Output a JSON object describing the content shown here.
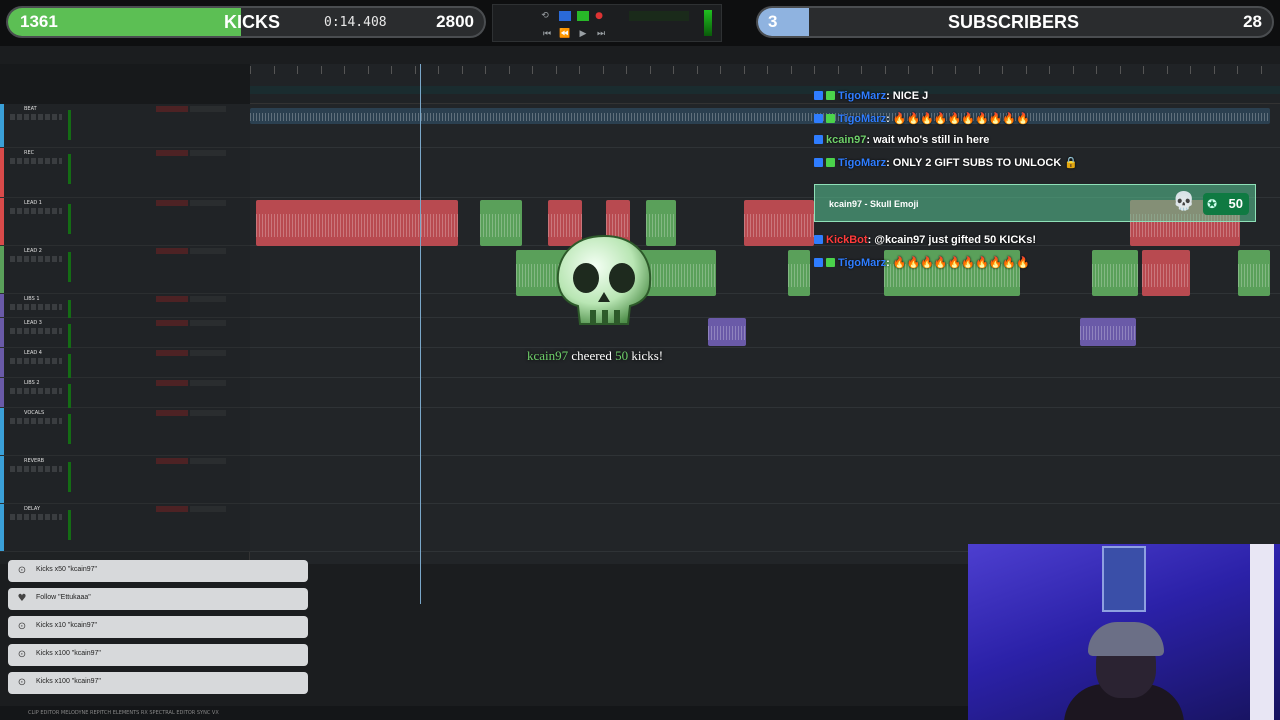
{
  "kicks_goal": {
    "left_value": "1361",
    "title": "KICKS",
    "timer": "0:14.408",
    "right_value": "2800",
    "progress_fraction": 0.49,
    "fill_color": "#5cbf54"
  },
  "subs_goal": {
    "left_value": "3",
    "title": "SUBSCRIBERS",
    "right_value": "28",
    "progress_fraction": 0.1,
    "fill_color": "#8fb3e0"
  },
  "chat": [
    {
      "user": "TigoMarz",
      "message": ": NICE J",
      "user_color": "#2f7dff"
    },
    {
      "user": "TigoMarz",
      "message": ": 🔥🔥🔥🔥🔥🔥🔥🔥🔥🔥",
      "user_color": "#2f7dff"
    },
    {
      "user": "kcain97",
      "message": ": wait who's still in here",
      "user_color": "#6fd06a"
    },
    {
      "user": "TigoMarz",
      "message": ": ONLY 2 GIFT SUBS TO UNLOCK 🔒",
      "user_color": "#2f7dff"
    },
    {
      "user": "KickBot",
      "message": ": @kcain97 just gifted 50 KICKs!",
      "user_color": "#ff3b3b"
    },
    {
      "user": "TigoMarz",
      "message": ": 🔥🔥🔥🔥🔥🔥🔥🔥🔥🔥",
      "user_color": "#2f7dff"
    }
  ],
  "redeem": {
    "user": "kcain97",
    "reward": "- Skull Emoji",
    "points": "50"
  },
  "cheer_alert": {
    "user": "kcain97",
    "verb": "cheered",
    "amount": "50",
    "unit": "kicks!"
  },
  "alerts": [
    {
      "icon": "kick-icon",
      "text": "Kicks x50 \"kcain97\""
    },
    {
      "icon": "heart-icon",
      "text": "Follow \"Ettukaaa\""
    },
    {
      "icon": "kick-icon",
      "text": "Kicks x10 \"kcain97\""
    },
    {
      "icon": "kick-icon",
      "text": "Kicks x100 \"kcain97\""
    },
    {
      "icon": "kick-icon",
      "text": "Kicks x100 \"kcain97\""
    }
  ],
  "daw_tracks": [
    {
      "name": "BEAT",
      "color": "#3aa0d8"
    },
    {
      "name": "REC",
      "color": "#d84a4a"
    },
    {
      "name": "LEAD 1",
      "color": "#d84a4a"
    },
    {
      "name": "LEAD 2",
      "color": "#5aa05a"
    },
    {
      "name": "LIBS 1",
      "color": "#6a5aa8"
    },
    {
      "name": "LEAD 3",
      "color": "#6a5aa8"
    },
    {
      "name": "LEAD 4",
      "color": "#6a5aa8"
    },
    {
      "name": "LIBS 2",
      "color": "#6a5aa8"
    },
    {
      "name": "VOCALS",
      "color": "#3aa0d8"
    },
    {
      "name": "REVERB",
      "color": "#3aa0d8"
    },
    {
      "name": "DELAY",
      "color": "#3aa0d8"
    }
  ],
  "status_bar": "CLIP EDITOR   MELODYNE   REPITCH ELEMENTS   RX SPECTRAL EDITOR   SYNC VX"
}
